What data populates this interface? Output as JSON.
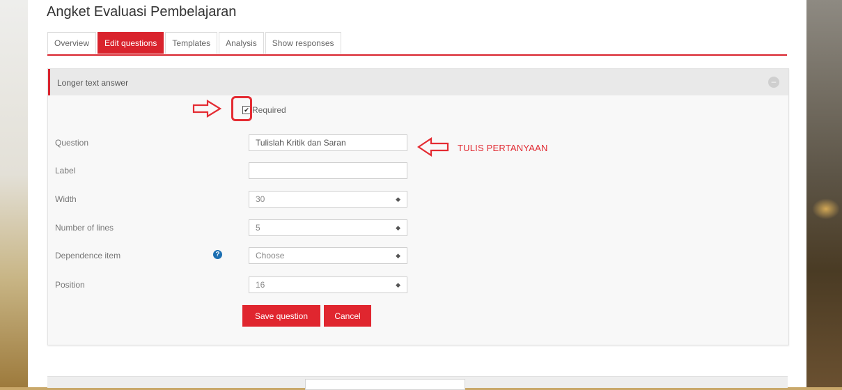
{
  "page": {
    "title": "Angket Evaluasi Pembelajaran"
  },
  "tabs": [
    {
      "label": "Overview",
      "active": false
    },
    {
      "label": "Edit questions",
      "active": true
    },
    {
      "label": "Templates",
      "active": false
    },
    {
      "label": "Analysis",
      "active": false
    },
    {
      "label": "Show responses",
      "active": false
    }
  ],
  "panel": {
    "header_title": "Longer text answer",
    "collapse_icon": "minus-circle-icon"
  },
  "form": {
    "required_label": "Required",
    "required_checked": true,
    "question_label": "Question",
    "question_value": "Tulislah Kritik dan Saran",
    "label_label": "Label",
    "label_value": "",
    "width_label": "Width",
    "width_value": "30",
    "lines_label": "Number of lines",
    "lines_value": "5",
    "dependence_label": "Dependence item",
    "dependence_value": "Choose",
    "position_label": "Position",
    "position_value": "16",
    "save_label": "Save question",
    "cancel_label": "Cancel"
  },
  "annotation": {
    "text": "TULIS PERTANYAAN",
    "color": "#e12b33"
  },
  "colors": {
    "accent": "#d9232d",
    "help": "#1c6fb2"
  }
}
